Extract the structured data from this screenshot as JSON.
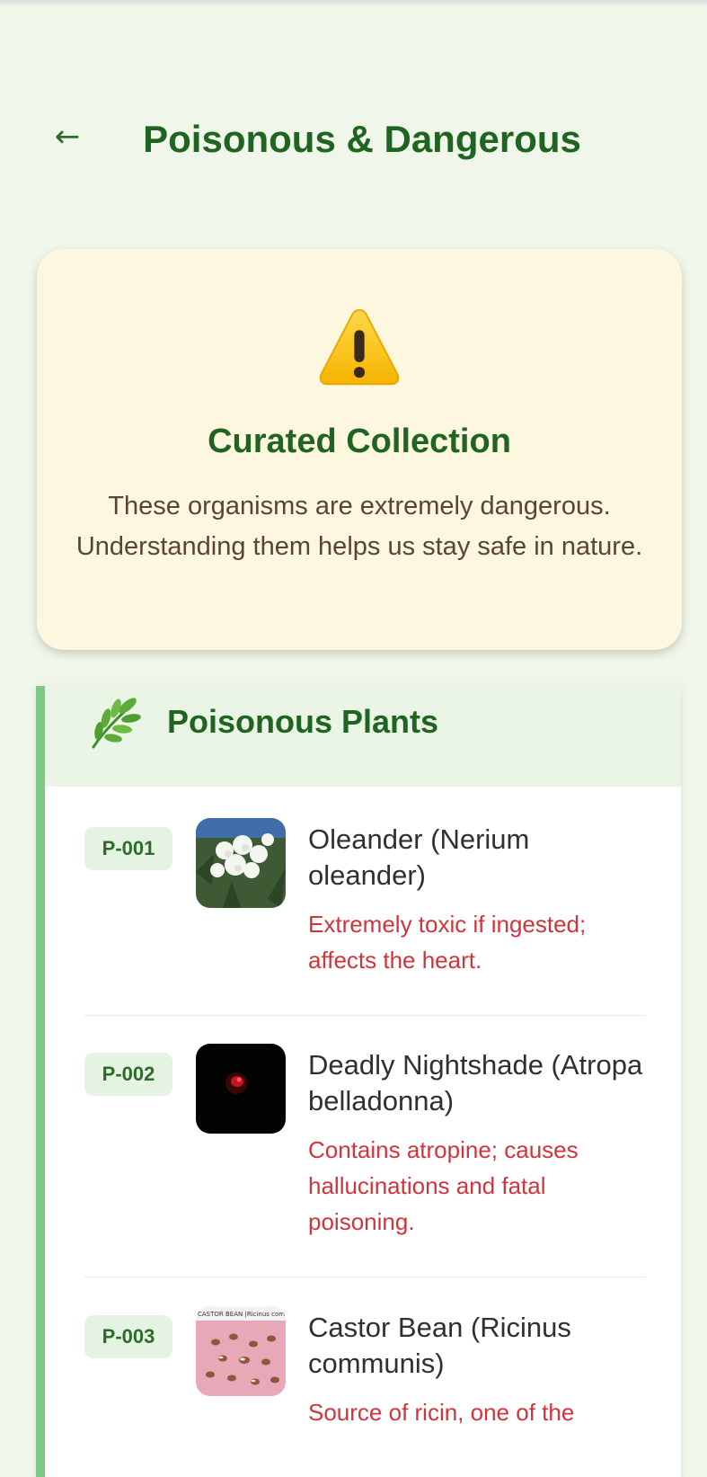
{
  "header": {
    "back_arrow": "←",
    "title": "Poisonous & Dangerous"
  },
  "notice": {
    "icon": "warning-icon",
    "title": "Curated Collection",
    "text": "These organisms are extremely dangerous. Understanding them helps us stay safe in nature."
  },
  "section": {
    "icon": "leaf-icon",
    "title": "Poisonous Plants",
    "accent_color": "#81c784",
    "items": [
      {
        "code": "P-001",
        "name": "Oleander (Nerium oleander)",
        "description": "Extremely toxic if ingested; affects the heart.",
        "image": "oleander-flowers"
      },
      {
        "code": "P-002",
        "name": "Deadly Nightshade (Atropa belladonna)",
        "description": "Contains atropine; causes hallucinations and fatal poisoning.",
        "image": "nightshade-dark"
      },
      {
        "code": "P-003",
        "name": "Castor Bean (Ricinus communis)",
        "description": "Source of ricin, one of the",
        "image": "castor-beans",
        "image_caption": "CASTOR BEAN |Ricinus comm"
      }
    ]
  },
  "colors": {
    "background": "#f0f6ea",
    "title_green": "#1f6420",
    "warning_card": "#fdf7df",
    "danger_red": "#d1343a"
  }
}
